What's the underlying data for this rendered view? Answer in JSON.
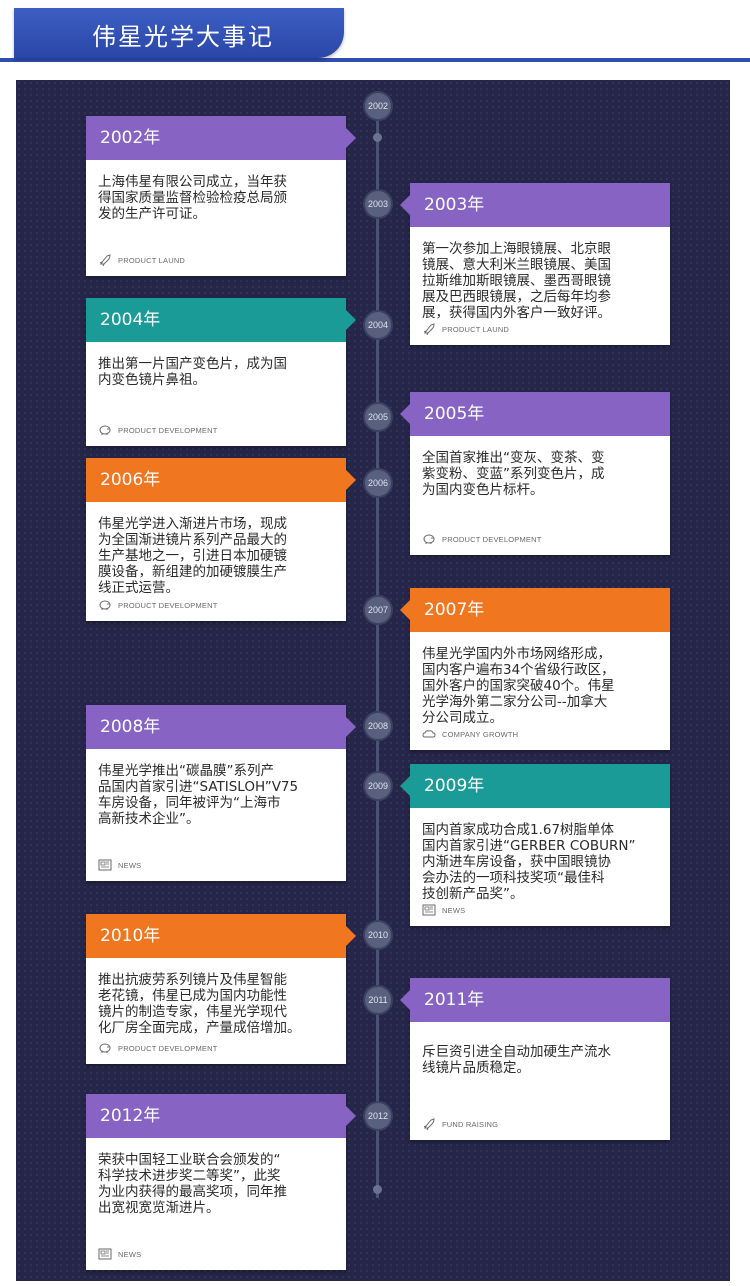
{
  "header": {
    "title": "伟星光学大事记"
  },
  "colors": {
    "purple": "#8763c4",
    "teal": "#1a9b97",
    "orange": "#f07620",
    "panel": "#25264a",
    "header": "#2f4db2"
  },
  "timeline_nodes": [
    "2002",
    "2003",
    "2004",
    "2005",
    "2006",
    "2007",
    "2008",
    "2009",
    "2010",
    "2011",
    "2012"
  ],
  "events": [
    {
      "year": "2002年",
      "text": "上海伟星有限公司成立，当年获\n得国家质量监督检验检疫总局颁\n发的生产许可证。",
      "tag": "PRODUCT LAUND",
      "icon": "rocket-icon",
      "color": "purple"
    },
    {
      "year": "2003年",
      "text": "第一次参加上海眼镜展、北京眼\n镜展、意大利米兰眼镜展、美国\n拉斯维加斯眼镜展、墨西哥眼镜\n展及巴西眼镜展，之后每年均参\n展，获得国内外客户一致好评。",
      "tag": "PRODUCT LAUND",
      "icon": "rocket-icon",
      "color": "purple"
    },
    {
      "year": "2004年",
      "text": "推出第一片国产变色片，成为国\n内变色镜片鼻祖。",
      "tag": "PRODUCT DEVELOPMENT",
      "icon": "piggy-bank-icon",
      "color": "teal"
    },
    {
      "year": "2005年",
      "text": "全国首家推出“变灰、变茶、变\n紫变粉、变蓝”系列变色片，成\n为国内变色片标杆。",
      "tag": "PRODUCT DEVELOPMENT",
      "icon": "piggy-bank-icon",
      "color": "purple"
    },
    {
      "year": "2006年",
      "text": "伟星光学进入渐进片市场，现成\n为全国渐进镜片系列产品最大的\n生产基地之一，引进日本加硬镀\n膜设备，新组建的加硬镀膜生产\n线正式运营。",
      "tag": "PRODUCT DEVELOPMENT",
      "icon": "piggy-bank-icon",
      "color": "orange"
    },
    {
      "year": "2007年",
      "text": "伟星光学国内外市场网络形成，\n国内客户遍布34个省级行政区，\n国外客户的国家突破40个。伟星\n光学海外第二家分公司--加拿大\n分公司成立。",
      "tag": "COMPANY GROWTH",
      "icon": "cloud-icon",
      "color": "orange"
    },
    {
      "year": "2008年",
      "text": "伟星光学推出“碳晶膜”系列产\n品国内首家引进“SATISLOH”V75\n车房设备，同年被评为“上海市\n高新技术企业”。",
      "tag": "NEWS",
      "icon": "newspaper-icon",
      "color": "purple"
    },
    {
      "year": "2009年",
      "text": "国内首家成功合成1.67树脂单体\n国内首家引进“GERBER COBURN”\n内渐进车房设备，获中国眼镜协\n会办法的一项科技奖项“最佳科\n技创新产品奖”。",
      "tag": "NEWS",
      "icon": "newspaper-icon",
      "color": "teal"
    },
    {
      "year": "2010年",
      "text": "推出抗疲劳系列镜片及伟星智能\n老花镜，伟星已成为国内功能性\n镜片的制造专家，伟星光学现代\n化厂房全面完成，产量成倍增加。",
      "tag": "PRODUCT DEVELOPMENT",
      "icon": "piggy-bank-icon",
      "color": "orange"
    },
    {
      "year": "2011年",
      "text": "斥巨资引进全自动加硬生产流水\n线镜片品质稳定。",
      "tag": "FUND RAISING",
      "icon": "rocket-icon",
      "color": "purple"
    },
    {
      "year": "2012年",
      "text": "荣获中国轻工业联合会颁发的“\n科学技术进步奖二等奖”，此奖\n为业内获得的最高奖项，同年推\n出宽视宽览渐进片。",
      "tag": "NEWS",
      "icon": "newspaper-icon",
      "color": "purple"
    }
  ]
}
